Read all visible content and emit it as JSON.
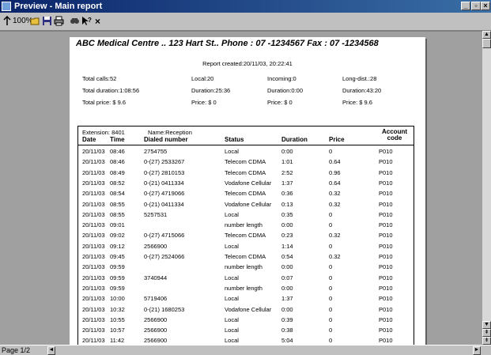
{
  "window": {
    "title": "Preview - Main report",
    "min_label": "_",
    "max_label": "▫",
    "close_label": "×"
  },
  "toolbar": {
    "zoom_label": "100%",
    "close_label": "×"
  },
  "status": {
    "page_label": "Page 1/2"
  },
  "report": {
    "header": "ABC Medical Centre .. 123 Hart St..   Phone : 07 -1234567    Fax : 07 -1234568",
    "created": "Report created:20/11/03, 20:22:41",
    "summary": {
      "total_calls": "Total calls:52",
      "local": "Local:20",
      "incoming": "Incoming:0",
      "long_dist": "Long-dist.:28",
      "total_duration": "Total duration:1:08:56",
      "duration_local": "Duration:25:36",
      "duration_incoming": "Duration:0:00",
      "duration_long": "Duration:43:20",
      "total_price": "Total price: $ 9.6",
      "price_local": "Price: $ 0",
      "price_incoming": "Price: $ 0",
      "price_long": "Price: $ 9.6"
    },
    "extension": "Extension: 8401",
    "name": "Name:Reception",
    "columns": {
      "date": "Date",
      "time": "Time",
      "dialed": "Dialed number",
      "status": "Status",
      "duration": "Duration",
      "price": "Price",
      "code_line1": "Account",
      "code_line2": "code"
    },
    "rows": [
      [
        "20/11/03",
        "08:46",
        "2754755",
        "Local",
        "0:00",
        "0",
        "P010"
      ],
      [
        "20/11/03",
        "08:46",
        "0-(27) 2533267",
        "Telecom CDMA",
        "1:01",
        "0.64",
        "P010"
      ],
      [
        "20/11/03",
        "08:49",
        "0-(27) 2810153",
        "Telecom CDMA",
        "2:52",
        "0.96",
        "P010"
      ],
      [
        "20/11/03",
        "08:52",
        "0-(21) 0411334",
        "Vodafone Cellular",
        "1:37",
        "0.64",
        "P010"
      ],
      [
        "20/11/03",
        "08:54",
        "0-(27) 4719066",
        "Telecom CDMA",
        "0:36",
        "0.32",
        "P010"
      ],
      [
        "20/11/03",
        "08:55",
        "0-(21) 0411334",
        "Vodafone Cellular",
        "0:13",
        "0.32",
        "P010"
      ],
      [
        "20/11/03",
        "08:55",
        "5257531",
        "Local",
        "0:35",
        "0",
        "P010"
      ],
      [
        "20/11/03",
        "09:01",
        "",
        "number length",
        "0:00",
        "0",
        "P010"
      ],
      [
        "20/11/03",
        "09:02",
        "0-(27) 4715066",
        "Telecom CDMA",
        "0:23",
        "0.32",
        "P010"
      ],
      [
        "20/11/03",
        "09:12",
        "2566900",
        "Local",
        "1:14",
        "0",
        "P010"
      ],
      [
        "20/11/03",
        "09:45",
        "0-(27) 2524066",
        "Telecom CDMA",
        "0:54",
        "0.32",
        "P010"
      ],
      [
        "20/11/03",
        "09:59",
        "",
        "number length",
        "0:00",
        "0",
        "P010"
      ],
      [
        "20/11/03",
        "09:59",
        "3740944",
        "Local",
        "0:07",
        "0",
        "P010"
      ],
      [
        "20/11/03",
        "09:59",
        "",
        "number length",
        "0:00",
        "0",
        "P010"
      ],
      [
        "20/11/03",
        "10:00",
        "5719406",
        "Local",
        "1:37",
        "0",
        "P010"
      ],
      [
        "20/11/03",
        "10:32",
        "0-(21) 1680253",
        "Vodafone Cellular",
        "0:00",
        "0",
        "P010"
      ],
      [
        "20/11/03",
        "10:55",
        "2566900",
        "Local",
        "0:39",
        "0",
        "P010"
      ],
      [
        "20/11/03",
        "10:57",
        "2566900",
        "Local",
        "0:38",
        "0",
        "P010"
      ],
      [
        "20/11/03",
        "11:42",
        "2566900",
        "Local",
        "5:04",
        "0",
        "P010"
      ]
    ]
  }
}
